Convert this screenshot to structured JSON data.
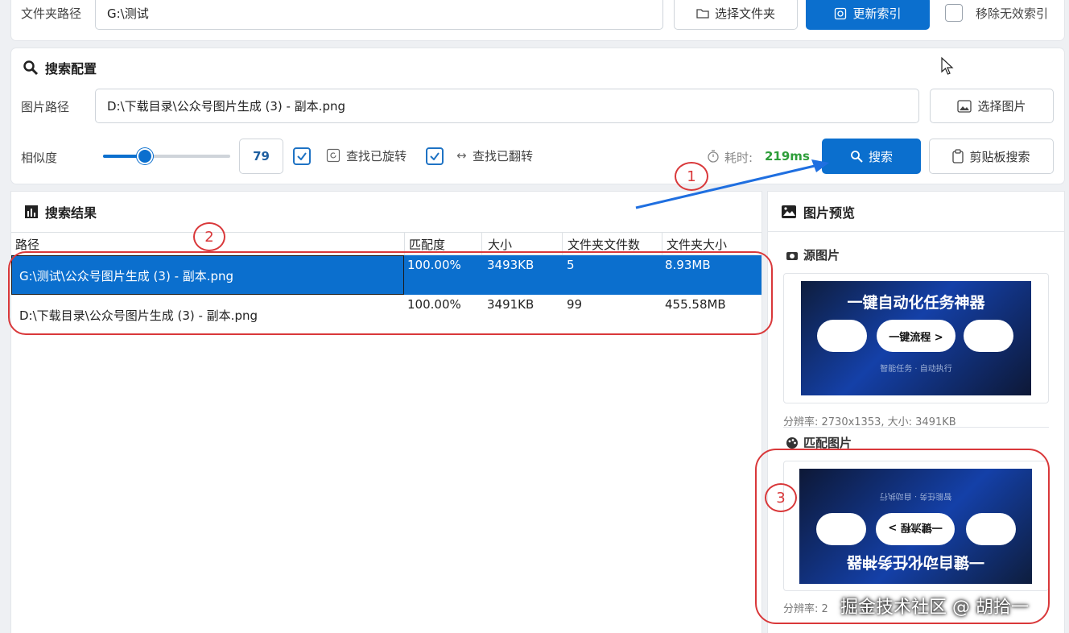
{
  "folder": {
    "label": "文件夹路径",
    "path_value": "G:\\测试",
    "choose_folder_label": "选择文件夹",
    "update_index_label": "更新索引",
    "remove_invalid_label": "移除无效索引"
  },
  "search_config": {
    "title": "搜索配置",
    "image_path_label": "图片路径",
    "image_path_value": "D:\\下载目录\\公众号图片生成 (3) - 副本.png",
    "choose_image_label": "选择图片",
    "similarity_label": "相似度",
    "similarity_value": "79",
    "slider_level": 0.79,
    "find_rotated_label": "查找已旋转",
    "find_flipped_label": "查找已翻转",
    "elapsed_label": "耗时:",
    "elapsed_value": "219ms",
    "search_label": "搜索",
    "clipboard_search_label": "剪贴板搜索"
  },
  "results": {
    "title": "搜索结果",
    "columns": [
      "路径",
      "匹配度",
      "大小",
      "文件夹文件数",
      "文件夹大小"
    ],
    "rows": [
      {
        "path": "G:\\测试\\公众号图片生成 (3) - 副本.png",
        "match": "100.00%",
        "size": "3493KB",
        "folder_files": "5",
        "folder_size": "8.93MB"
      },
      {
        "path": "D:\\下载目录\\公众号图片生成 (3) - 副本.png",
        "match": "100.00%",
        "size": "3491KB",
        "folder_files": "99",
        "folder_size": "455.58MB"
      }
    ]
  },
  "preview": {
    "title": "图片预览",
    "source_label": "源图片",
    "source_caption": "分辨率: 2730x1353, 大小: 3491KB",
    "match_label": "匹配图片",
    "match_caption": "分辨率: 2",
    "thumb_title": "一键自动化任务神器",
    "thumb_button": "一键流程 >",
    "thumb_sub": "智能任务 · 自动执行"
  },
  "annotations": [
    "1",
    "2",
    "3"
  ],
  "watermark": "掘金技术社区 @ 胡拾一",
  "colors": {
    "accent": "#0b6fce",
    "annotation": "#d9383a",
    "elapsed": "#2e9e3a"
  }
}
